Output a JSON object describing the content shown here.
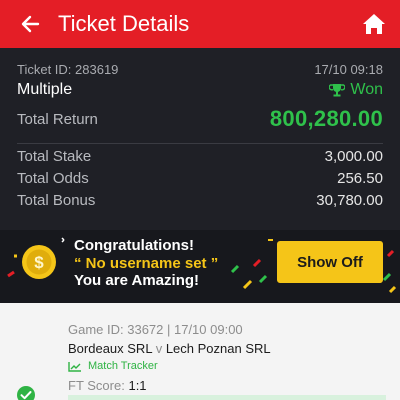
{
  "header": {
    "title": "Ticket Details"
  },
  "ticket": {
    "id_text": "Ticket ID: 283619",
    "datetime": "17/10 09:18",
    "type": "Multiple",
    "status": "Won",
    "total_return_label": "Total Return",
    "total_return_value": "800,280.00",
    "total_stake_label": "Total Stake",
    "total_stake_value": "3,000.00",
    "total_odds_label": "Total Odds",
    "total_odds_value": "256.50",
    "total_bonus_label": "Total Bonus",
    "total_bonus_value": "30,780.00"
  },
  "congrats": {
    "line1": "Congratulations!",
    "line2": "“ No username set ”",
    "line3": "You are Amazing!",
    "button": "Show Off"
  },
  "bet": {
    "game_meta": "Game ID: 33672 | 17/10 09:00",
    "home_team": "Bordeaux SRL",
    "vs": "v",
    "away_team": "Lech Poznan SRL",
    "tracker": "Match Tracker",
    "ft_label": "FT Score:",
    "ft_value": "1:1"
  },
  "colors": {
    "brand_red": "#e41e26",
    "won_green": "#2fc14b",
    "accent_yellow": "#f5c518",
    "panel_dark": "#1f2026"
  },
  "icons": [
    "back-arrow-icon",
    "home-icon",
    "trophy-icon",
    "coin-icon",
    "chart-icon",
    "check-circle-icon"
  ]
}
